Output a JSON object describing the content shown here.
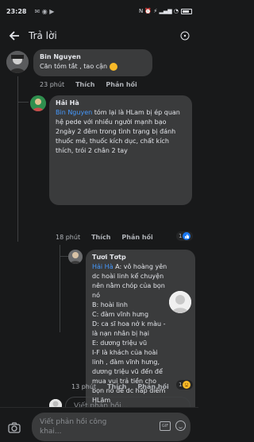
{
  "status": {
    "time": "23:28",
    "notif_icons": "✉ ◉ ▶",
    "right_icons": "N ⏰ ⚡ ▂▄▆ ◔"
  },
  "header": {
    "title": "Trả lời"
  },
  "comments": [
    {
      "author": "Bin Nguyen",
      "text": "Căn tóm tắt , tao cận",
      "time": "23 phút",
      "like_label": "Thích",
      "reply_label": "Phản hồi"
    },
    {
      "author": "Hải Hà",
      "mention": "Bin Nguyen",
      "text": " tóm lại là HLam bị ép quan hệ pede với nhiều người mạnh bạo 2ngày 2 đêm trong tình trạng bị đánh thuốc mê, thuốc kích dục, chất kích thích, trói 2 chân 2 tay",
      "time": "18 phút",
      "like_label": "Thích",
      "reply_label": "Phản hồi",
      "reaction_count": "1"
    },
    {
      "author": "Tươi Tơtp",
      "mention": "Hải Hà",
      "text": " A: vô hoàng yên dc hoài linh kể chuyện nên nằm chóp của bọn nó\nB: hoài linh\nC: đàm vĩnh hưng\nD: ca sĩ hoa nở k màu - là nạn nhân bị hại\nE: dương triệu vũ\nI-F là khách của hoài linh , đàm vĩnh hưng, dương triệu vũ đến để mua vui trả tiền cho bọn nó để dc hấp diêm HLâm",
      "time": "13 phút",
      "like_label": "Thích",
      "reply_label": "Phản hồi",
      "reaction_count": "1"
    }
  ],
  "reply_placeholder": "Viết phản hồi...",
  "bottom": {
    "comment_placeholder": "Viết phản hồi công khai...",
    "gif_label": "GIF"
  }
}
